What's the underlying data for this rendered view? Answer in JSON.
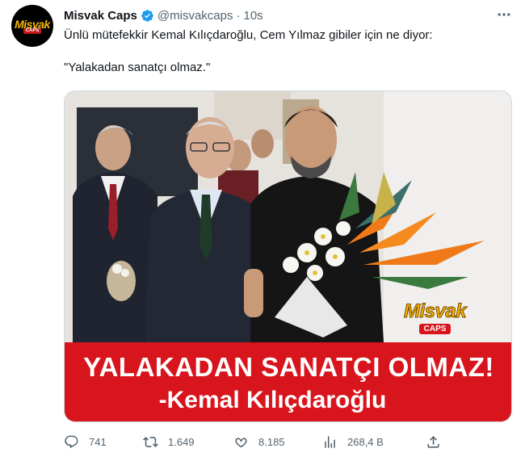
{
  "tweet": {
    "author_name": "Misvak Caps",
    "author_handle": "@misvakcaps",
    "separator": "·",
    "time": "10s",
    "text": "Ünlü mütefekkir Kemal Kılıçdaroğlu, Cem Yılmaz gibiler için ne diyor:\n\n\"Yalakadan sanatçı olmaz.\"",
    "avatar_logo": {
      "line1": "Misvak",
      "line2": "CAPS"
    }
  },
  "media": {
    "banner_line1": "YALAKADAN SANATÇI OLMAZ!",
    "banner_line2": "-Kemal Kılıçdaroğlu",
    "watermark_line1": "Misvak",
    "watermark_line2": "CAPS",
    "colors": {
      "banner": "#d8141c",
      "logo_yellow": "#f5b700"
    }
  },
  "actions": {
    "replies": "741",
    "retweets": "1.649",
    "likes": "8.185",
    "views": "268,4 B"
  },
  "icons": [
    "verified-badge-icon",
    "more-icon",
    "reply-icon",
    "retweet-icon",
    "like-icon",
    "views-icon",
    "share-icon"
  ]
}
